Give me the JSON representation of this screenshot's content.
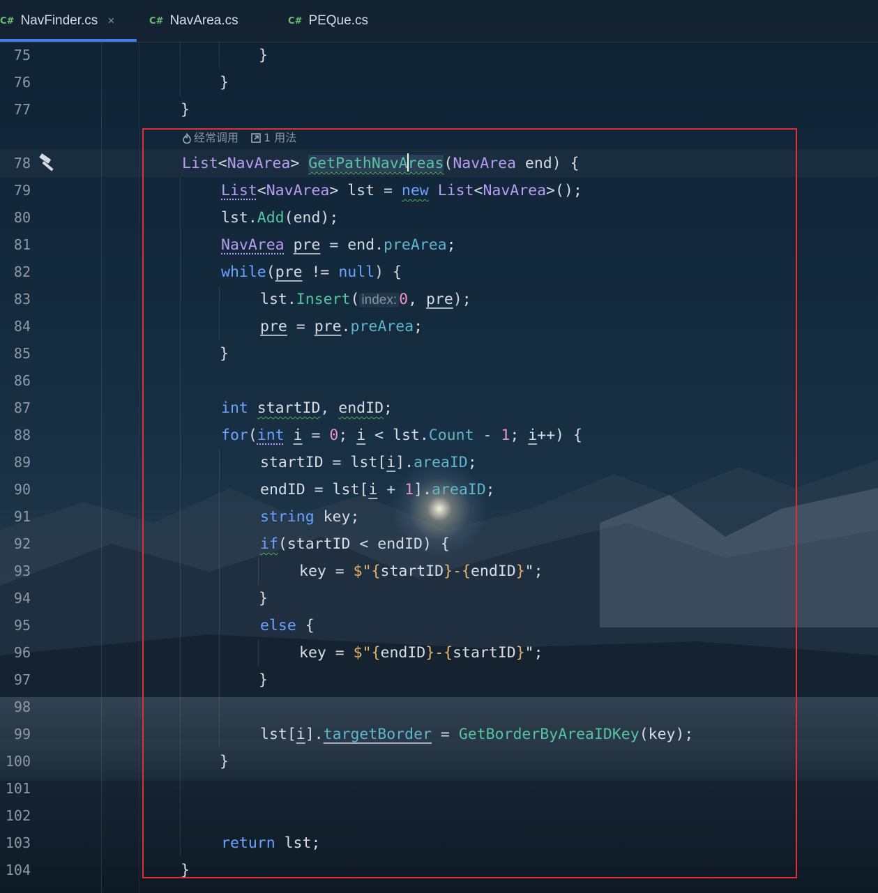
{
  "tabs": [
    {
      "lang": "C#",
      "label": "NavFinder.cs",
      "active": true,
      "close": "×"
    },
    {
      "lang": "C#",
      "label": "NavArea.cs",
      "active": false
    },
    {
      "lang": "C#",
      "label": "PEQue.cs",
      "active": false
    }
  ],
  "code_vision": {
    "frequent_label": "经常调用",
    "usages_label": "1 用法",
    "frequent_icon": "flame-icon",
    "usages_icon": "external-link-icon"
  },
  "gutter_icon": "hammer-icon",
  "line_numbers": [
    "75",
    "76",
    "77",
    "78",
    "79",
    "80",
    "81",
    "82",
    "83",
    "84",
    "85",
    "86",
    "87",
    "88",
    "89",
    "90",
    "91",
    "92",
    "93",
    "94",
    "95",
    "96",
    "97",
    "98",
    "99",
    "100",
    "101",
    "102",
    "103",
    "104"
  ],
  "code": {
    "l75": "}",
    "l76": "}",
    "l77": "}",
    "l78": {
      "t1": "List",
      "t2": "<",
      "t3": "NavArea",
      "t4": "> ",
      "t5": "GetPathNavA",
      "t6": "reas",
      "t7": "(",
      "t8": "NavArea",
      "t9": " end) {"
    },
    "l79": {
      "t1": "List",
      "t2": "<",
      "t3": "NavArea",
      "t4": "> lst = ",
      "t5": "new",
      "t6": " ",
      "t7": "List",
      "t8": "<",
      "t9": "NavArea",
      "t10": ">();"
    },
    "l80": {
      "t1": "lst.",
      "t2": "Add",
      "t3": "(end);"
    },
    "l81": {
      "t1": "NavArea",
      "t2": " ",
      "t3": "pre",
      "t4": " = end.",
      "t5": "preArea",
      "t6": ";"
    },
    "l82": {
      "t1": "while",
      "t2": "(",
      "t3": "pre",
      "t4": " != ",
      "t5": "null",
      "t6": ") {"
    },
    "l83": {
      "t1": "lst.",
      "t2": "Insert",
      "t3": "(",
      "hint": "index:",
      "t4": "0",
      "t5": ", ",
      "t6": "pre",
      "t7": ");"
    },
    "l84": {
      "t1": "pre",
      "t2": " = ",
      "t3": "pre",
      "t4": ".",
      "t5": "preArea",
      "t6": ";"
    },
    "l85": "}",
    "l87": {
      "t1": "int",
      "t2": " ",
      "t3": "startID",
      "t4": ", ",
      "t5": "endID",
      "t6": ";"
    },
    "l88": {
      "t1": "for",
      "t2": "(",
      "t3": "int",
      "t4": " ",
      "t5": "i",
      "t6": " = ",
      "t7": "0",
      "t8": "; ",
      "t9": "i",
      "t10": " < lst.",
      "t11": "Count",
      "t12": " - ",
      "t13": "1",
      "t14": "; ",
      "t15": "i",
      "t16": "++) {"
    },
    "l89": {
      "t1": "startID = lst[",
      "t2": "i",
      "t3": "].",
      "t4": "areaID",
      "t5": ";"
    },
    "l90": {
      "t1": "endID = lst[",
      "t2": "i",
      "t3": " + ",
      "t4": "1",
      "t5": "].",
      "t6": "areaID",
      "t7": ";"
    },
    "l91": {
      "t1": "string",
      "t2": " key;"
    },
    "l92": {
      "t1": "if",
      "t2": "(startID < endID) {"
    },
    "l93": {
      "t1": "key = ",
      "t2": "$\"",
      "t3": "{",
      "t4": "startID",
      "t5": "}",
      "t6": "-",
      "t7": "{",
      "t8": "endID",
      "t9": "}",
      "t10": "\";"
    },
    "l94": "}",
    "l95": {
      "t1": "else",
      "t2": " {"
    },
    "l96": {
      "t1": "key = ",
      "t2": "$\"",
      "t3": "{",
      "t4": "endID",
      "t5": "}",
      "t6": "-",
      "t7": "{",
      "t8": "startID",
      "t9": "}",
      "t10": "\";"
    },
    "l97": "}",
    "l99": {
      "t1": "lst[",
      "t2": "i",
      "t3": "].",
      "t4": "targetBorder",
      "t5": " = ",
      "t6": "GetBorderByAreaIDKey",
      "t7": "(key);"
    },
    "l100": "}",
    "l103": {
      "t1": "return",
      "t2": " lst;"
    },
    "l104": "}"
  },
  "colors": {
    "keyword": "#6aa2ff",
    "type": "#b89cf0",
    "method": "#56c4a0",
    "field": "#5fb6c8",
    "number": "#ed94c0",
    "highlight_box": "#e23030",
    "active_tab_underline": "#3d7ce0"
  }
}
